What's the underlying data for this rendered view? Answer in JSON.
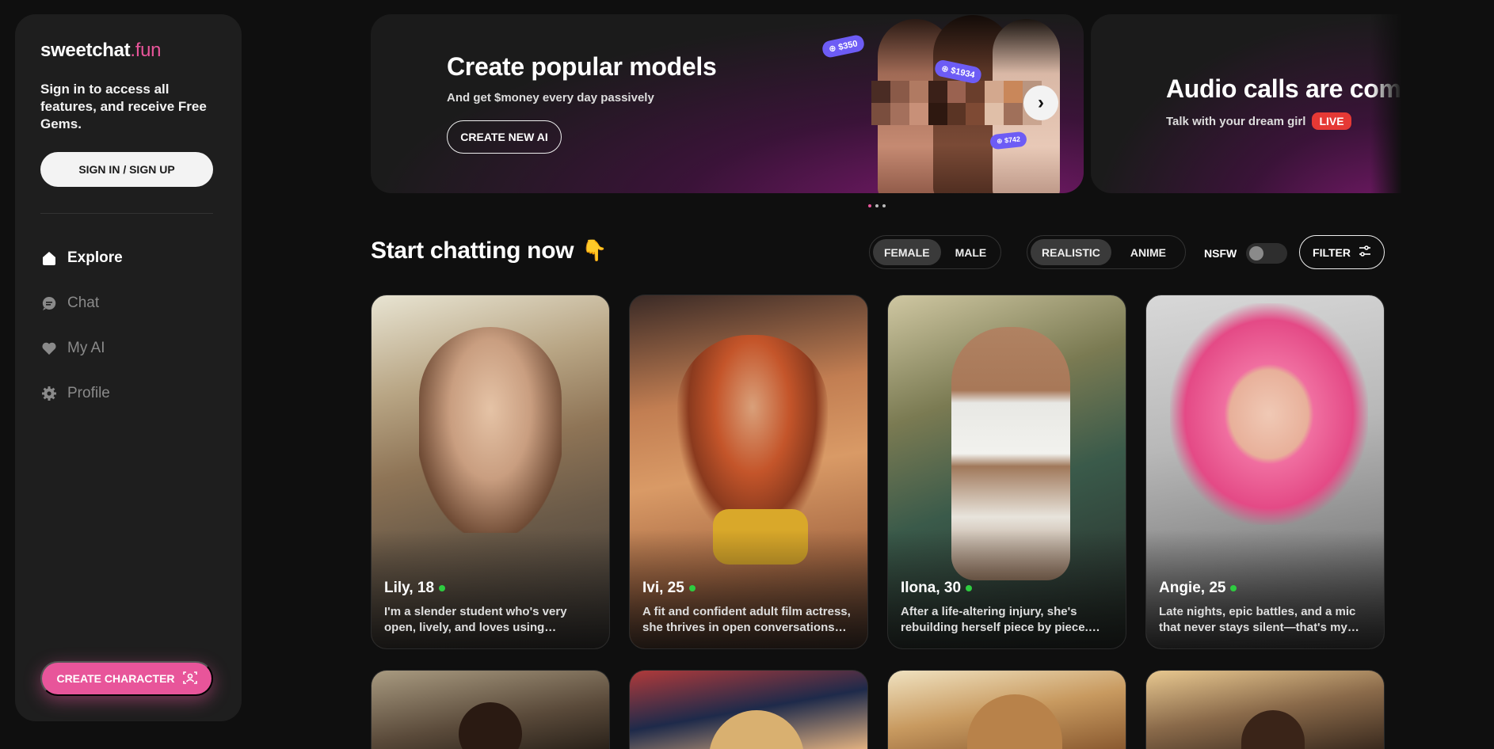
{
  "sidebar": {
    "logo_main": "sweetchat",
    "logo_accent": ".fun",
    "signin_text": "Sign in to access all features, and receive Free Gems.",
    "signin_button": "SIGN IN / SIGN UP",
    "nav": [
      {
        "label": "Explore",
        "icon": "home-icon",
        "active": true
      },
      {
        "label": "Chat",
        "icon": "chat-bubble-icon",
        "active": false
      },
      {
        "label": "My AI",
        "icon": "heart-icon",
        "active": false
      },
      {
        "label": "Profile",
        "icon": "gear-icon",
        "active": false
      }
    ],
    "create_button": "CREATE CHARACTER"
  },
  "banners": [
    {
      "title": "Create popular models",
      "subtitle": "And get $money every day passively",
      "button": "CREATE NEW AI",
      "tags": [
        "$350",
        "$1934",
        "$742"
      ]
    },
    {
      "title": "Audio calls are comin",
      "subtitle": "Talk with your dream girl",
      "badge": "LIVE"
    }
  ],
  "main": {
    "section_title": "Start chatting now",
    "section_emoji": "👇",
    "gender_options": [
      "FEMALE",
      "MALE"
    ],
    "gender_selected": "FEMALE",
    "style_options": [
      "REALISTIC",
      "ANIME"
    ],
    "style_selected": "REALISTIC",
    "nsfw_label": "NSFW",
    "nsfw_on": false,
    "filter_label": "FILTER"
  },
  "cards": [
    {
      "name": "Lily, 18",
      "desc": "I'm a slender student who's very open, lively, and loves using…"
    },
    {
      "name": "Ivi, 25",
      "desc": "A fit and confident adult film actress, she thrives in open conversations…"
    },
    {
      "name": "Ilona, 30",
      "desc": "After a life-altering injury, she's rebuilding herself piece by piece.…"
    },
    {
      "name": "Angie, 25",
      "desc": "Late nights, epic battles, and a mic that never stays silent—that's my…"
    }
  ],
  "colors": {
    "accent": "#e8559a",
    "online": "#2ecc40",
    "live": "#e53935",
    "tag": "#6d5cf5"
  }
}
